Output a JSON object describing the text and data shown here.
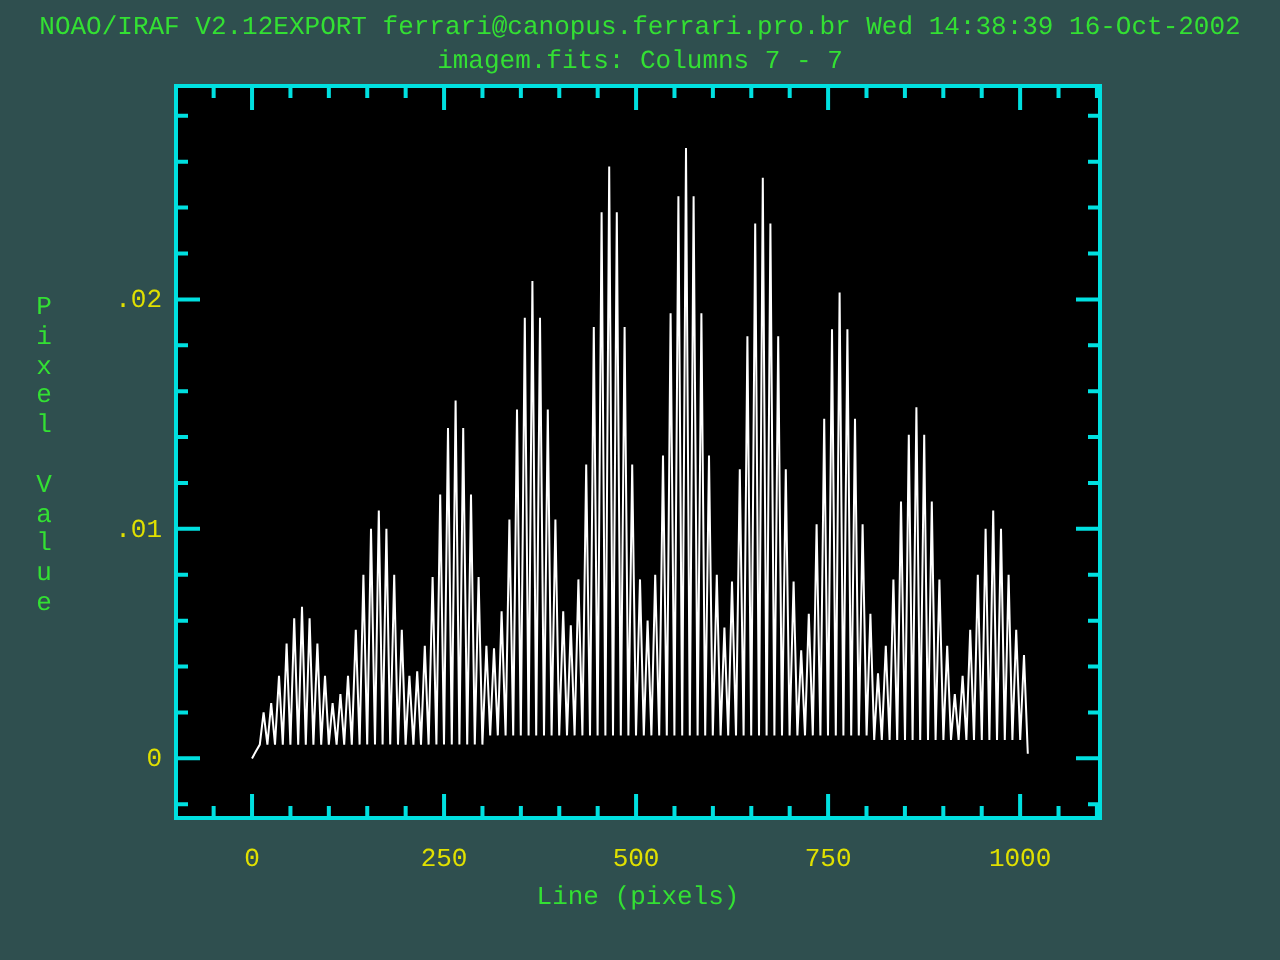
{
  "header": "NOAO/IRAF V2.12EXPORT ferrari@canopus.ferrari.pro.br Wed 14:38:39 16-Oct-2002",
  "plot": {
    "chart_data": {
      "type": "line",
      "title": "imagem.fits: Columns 7 - 7",
      "xlabel": "Line (pixels)",
      "ylabel": "Pixel Value",
      "xlim": [
        -99,
        1104
      ],
      "ylim": [
        -0.0026,
        0.0293
      ],
      "xticks": [
        0,
        250,
        500,
        750,
        1000
      ],
      "yticks": [
        {
          "value": 0,
          "label": "0"
        },
        {
          "value": 0.01,
          "label": ".01"
        },
        {
          "value": 0.02,
          "label": ".02"
        }
      ],
      "x": [
        0,
        5,
        10,
        15,
        20,
        25,
        30,
        35,
        40,
        45,
        50,
        55,
        60,
        65,
        70,
        75,
        80,
        85,
        90,
        95,
        100,
        105,
        110,
        115,
        120,
        125,
        130,
        135,
        140,
        145,
        150,
        155,
        160,
        165,
        170,
        175,
        180,
        185,
        190,
        195,
        200,
        205,
        210,
        215,
        220,
        225,
        230,
        235,
        240,
        245,
        250,
        255,
        260,
        265,
        270,
        275,
        280,
        285,
        290,
        295,
        300,
        305,
        310,
        315,
        320,
        325,
        330,
        335,
        340,
        345,
        350,
        355,
        360,
        365,
        370,
        375,
        380,
        385,
        390,
        395,
        400,
        405,
        410,
        415,
        420,
        425,
        430,
        435,
        440,
        445,
        450,
        455,
        460,
        465,
        470,
        475,
        480,
        485,
        490,
        495,
        500,
        505,
        510,
        515,
        520,
        525,
        530,
        535,
        540,
        545,
        550,
        555,
        560,
        565,
        570,
        575,
        580,
        585,
        590,
        595,
        600,
        605,
        610,
        615,
        620,
        625,
        630,
        635,
        640,
        645,
        650,
        655,
        660,
        665,
        670,
        675,
        680,
        685,
        690,
        695,
        700,
        705,
        710,
        715,
        720,
        725,
        730,
        735,
        740,
        745,
        750,
        755,
        760,
        765,
        770,
        775,
        780,
        785,
        790,
        795,
        800,
        805,
        810,
        815,
        820,
        825,
        830,
        835,
        840,
        845,
        850,
        855,
        860,
        865,
        870,
        875,
        880,
        885,
        890,
        895,
        900,
        905,
        910,
        915,
        920,
        925,
        930,
        935,
        940,
        945,
        950,
        955,
        960,
        965,
        970,
        975,
        980,
        985,
        990,
        995,
        1000,
        1005,
        1010
      ],
      "series": [
        {
          "color": "#ffffff",
          "values": [
            0,
            0.0003,
            0.0006,
            0.002,
            0.0006,
            0.0024,
            0.0006,
            0.0036,
            0.0006,
            0.005,
            0.0006,
            0.0061,
            0.0006,
            0.0066,
            0.0006,
            0.0061,
            0.0006,
            0.005,
            0.0006,
            0.0036,
            0.0006,
            0.0024,
            0.0006,
            0.0028,
            0.0006,
            0.0036,
            0.0006,
            0.0056,
            0.0006,
            0.008,
            0.0006,
            0.01,
            0.0006,
            0.0108,
            0.0006,
            0.01,
            0.0006,
            0.008,
            0.0006,
            0.0056,
            0.0006,
            0.0036,
            0.0006,
            0.0038,
            0.0006,
            0.0049,
            0.0006,
            0.0079,
            0.0006,
            0.0115,
            0.0006,
            0.0144,
            0.0006,
            0.0156,
            0.0006,
            0.0144,
            0.0006,
            0.0115,
            0.0006,
            0.0079,
            0.0006,
            0.0049,
            0.001,
            0.0048,
            0.001,
            0.0064,
            0.001,
            0.0104,
            0.001,
            0.0152,
            0.001,
            0.0192,
            0.001,
            0.0208,
            0.001,
            0.0192,
            0.001,
            0.0152,
            0.001,
            0.0104,
            0.001,
            0.0064,
            0.001,
            0.0058,
            0.001,
            0.0078,
            0.001,
            0.0128,
            0.001,
            0.0188,
            0.001,
            0.0238,
            0.001,
            0.0258,
            0.001,
            0.0238,
            0.001,
            0.0188,
            0.001,
            0.0128,
            0.001,
            0.0078,
            0.001,
            0.006,
            0.001,
            0.008,
            0.001,
            0.0132,
            0.001,
            0.0194,
            0.001,
            0.0245,
            0.001,
            0.0266,
            0.001,
            0.0245,
            0.001,
            0.0194,
            0.001,
            0.0132,
            0.001,
            0.008,
            0.001,
            0.0057,
            0.001,
            0.0077,
            0.001,
            0.0126,
            0.001,
            0.0184,
            0.001,
            0.0233,
            0.001,
            0.0253,
            0.001,
            0.0233,
            0.001,
            0.0184,
            0.001,
            0.0126,
            0.001,
            0.0077,
            0.001,
            0.0047,
            0.001,
            0.0063,
            0.001,
            0.0102,
            0.001,
            0.0148,
            0.001,
            0.0187,
            0.001,
            0.0203,
            0.001,
            0.0187,
            0.001,
            0.0148,
            0.001,
            0.0102,
            0.001,
            0.0063,
            0.0008,
            0.0037,
            0.0008,
            0.0049,
            0.0008,
            0.0078,
            0.0008,
            0.0112,
            0.0008,
            0.0141,
            0.0008,
            0.0153,
            0.0008,
            0.0141,
            0.0008,
            0.0112,
            0.0008,
            0.0078,
            0.0008,
            0.0049,
            0.0008,
            0.0028,
            0.0008,
            0.0036,
            0.0008,
            0.0056,
            0.0008,
            0.008,
            0.0008,
            0.01,
            0.0008,
            0.0108,
            0.0008,
            0.01,
            0.0008,
            0.008,
            0.0008,
            0.0056,
            0.0008,
            0.0045,
            0.0002
          ]
        }
      ]
    }
  }
}
